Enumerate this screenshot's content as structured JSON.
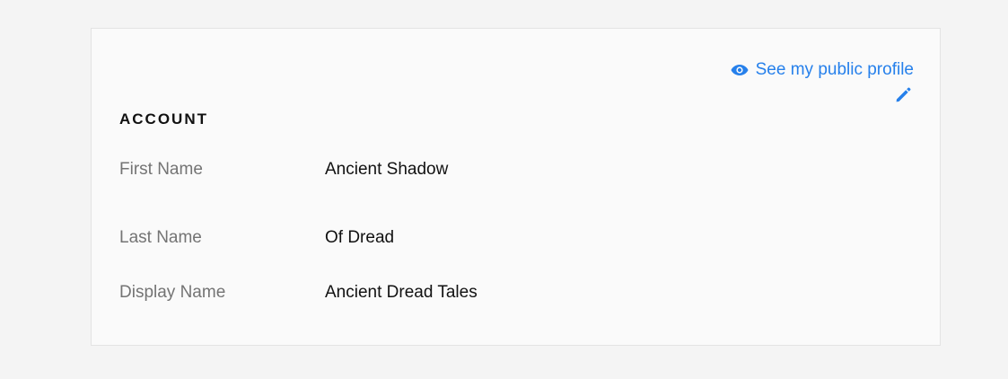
{
  "card": {
    "public_profile_link": "See my public profile",
    "section_title": "ACCOUNT",
    "fields": [
      {
        "label": "First Name",
        "value": "Ancient Shadow"
      },
      {
        "label": "Last Name",
        "value": "Of Dread"
      },
      {
        "label": "Display Name",
        "value": "Ancient Dread Tales"
      }
    ]
  },
  "icons": {
    "profile_link_icon": "eye-icon",
    "edit_icon": "pencil-icon"
  },
  "colors": {
    "accent": "#2680eb",
    "label": "#747474",
    "value": "#111111",
    "card_bg": "#fafafa",
    "page_bg": "#f4f4f4"
  }
}
